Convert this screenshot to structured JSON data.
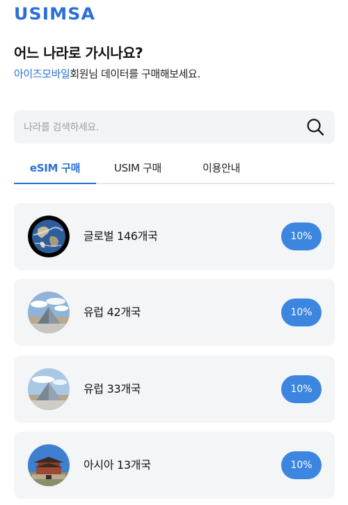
{
  "brand": {
    "logo": "USIMSA"
  },
  "intro": {
    "headline": "어느 나라로 가시나요?",
    "brand_name": "아이즈모바일",
    "subline_rest": "회원님 데이터를 구매해보세요."
  },
  "search": {
    "placeholder": "나라를 검색하세요.",
    "icon": "search-icon"
  },
  "tabs": [
    {
      "label": "eSIM 구매",
      "active": true
    },
    {
      "label": "USIM 구매",
      "active": false
    },
    {
      "label": "이용안내",
      "active": false
    }
  ],
  "products": [
    {
      "label": "글로벌 146개국",
      "badge": "10%",
      "image": "earth"
    },
    {
      "label": "유럽 42개국",
      "badge": "10%",
      "image": "louvre-pyramid"
    },
    {
      "label": "유럽 33개국",
      "badge": "10%",
      "image": "louvre-pyramid"
    },
    {
      "label": "아시아 13개국",
      "badge": "10%",
      "image": "korean-palace-gate"
    }
  ],
  "colors": {
    "accent": "#2a6fd6",
    "badge": "#3d86e0",
    "card_bg": "#f4f5f7"
  }
}
